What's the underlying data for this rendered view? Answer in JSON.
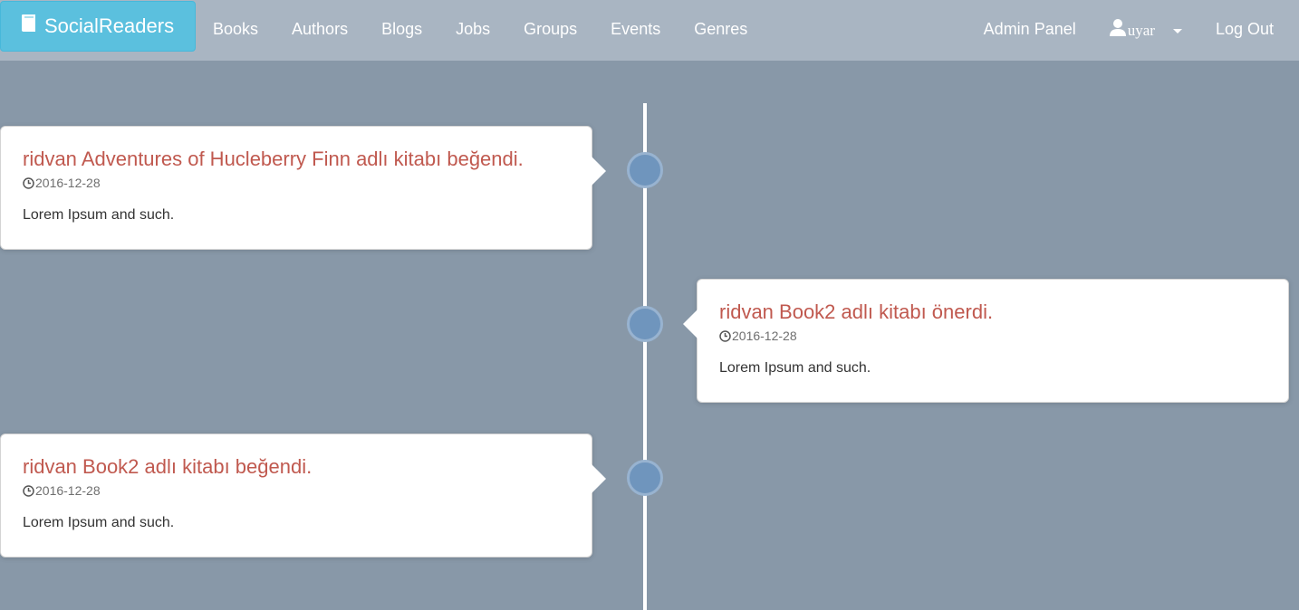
{
  "navbar": {
    "brand": "SocialReaders",
    "brand_icon": "book-icon",
    "links": [
      "Books",
      "Authors",
      "Blogs",
      "Jobs",
      "Groups",
      "Events",
      "Genres"
    ],
    "admin_panel": "Admin Panel",
    "user": {
      "name": "uyar",
      "icon": "user-icon"
    },
    "logout": "Log Out"
  },
  "timeline": [
    {
      "side": "left",
      "title": "ridvan Adventures of Hucleberry Finn adlı kitabı beğendi.",
      "date": "2016-12-28",
      "body": "Lorem Ipsum and such."
    },
    {
      "side": "right",
      "title": "ridvan Book2 adlı kitabı önerdi.",
      "date": "2016-12-28",
      "body": "Lorem Ipsum and such."
    },
    {
      "side": "left",
      "title": "ridvan Book2 adlı kitabı beğendi.",
      "date": "2016-12-28",
      "body": "Lorem Ipsum and such."
    }
  ],
  "colors": {
    "background": "#8898a8",
    "navbar": "#a9b5c2",
    "brand": "#5bc0de",
    "title": "#c0594f",
    "dot": "#6f95bd"
  }
}
